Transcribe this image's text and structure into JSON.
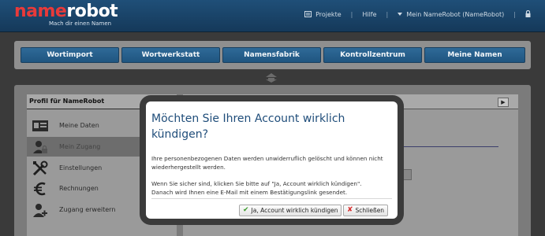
{
  "header": {
    "logo_name": "name",
    "logo_robot": "robot",
    "tagline": "Mach dir einen Namen",
    "links": [
      {
        "label": "Projekte",
        "icon": "projects-icon"
      },
      {
        "label": "Hilfe"
      },
      {
        "label": "Mein NameRobot (NameRobot)",
        "icon": "chevron-down-icon"
      }
    ],
    "lock_icon": "lock-icon"
  },
  "nav": {
    "items": [
      "Wortimport",
      "Wortwerkstatt",
      "Namensfabrik",
      "Kontrollzentrum",
      "Meine Namen"
    ]
  },
  "sidebar": {
    "title": "Profil für NameRobot",
    "items": [
      {
        "label": "Meine Daten",
        "icon": "id-card-icon"
      },
      {
        "label": "Mein Zugang",
        "icon": "user-lock-icon",
        "active": true
      },
      {
        "label": "Einstellungen",
        "icon": "tools-icon"
      },
      {
        "label": "Rechnungen",
        "icon": "euro-icon"
      },
      {
        "label": "Zugang erweitern",
        "icon": "user-add-icon"
      }
    ]
  },
  "dialog": {
    "title": "Möchten Sie Ihren Account wirklich kündigen?",
    "paragraph1": "Ihre personenbezogenen Daten werden unwiderruflich gelöscht und können nicht wiederhergestellt werden.",
    "paragraph2": "Wenn Sie sicher sind, klicken Sie bitte auf \"Ja, Account wirklich kündigen\".",
    "paragraph3": "Danach wird Ihnen eine E-Mail mit einem Bestätigungslink gesendet.",
    "confirm_label": "Ja, Account wirklich kündigen",
    "close_label": "Schließen"
  },
  "colors": {
    "brand_blue": "#1f4d7a",
    "logo_red": "#e83a3a",
    "confirm_green": "#3a9a2a",
    "close_red": "#d62a2a"
  }
}
